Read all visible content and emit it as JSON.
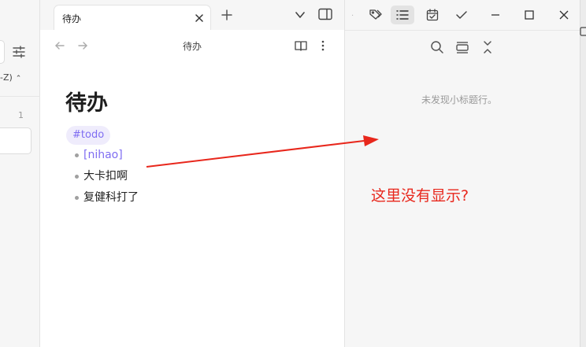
{
  "left": {
    "sort_label": "-Z)",
    "count": "1"
  },
  "tab": {
    "title": "待办"
  },
  "editor": {
    "view_title": "待办",
    "heading": "待办",
    "tag": "#todo",
    "items": [
      "[nihao]",
      "大卡扣啊",
      "复健科打了"
    ]
  },
  "right_panel": {
    "empty_message": "未发现小标题行。"
  },
  "annotation": {
    "text": "这里没有显示?",
    "color": "#e8271c"
  },
  "colors": {
    "accent": "#7f6df2",
    "tag_bg": "#efecfc"
  }
}
